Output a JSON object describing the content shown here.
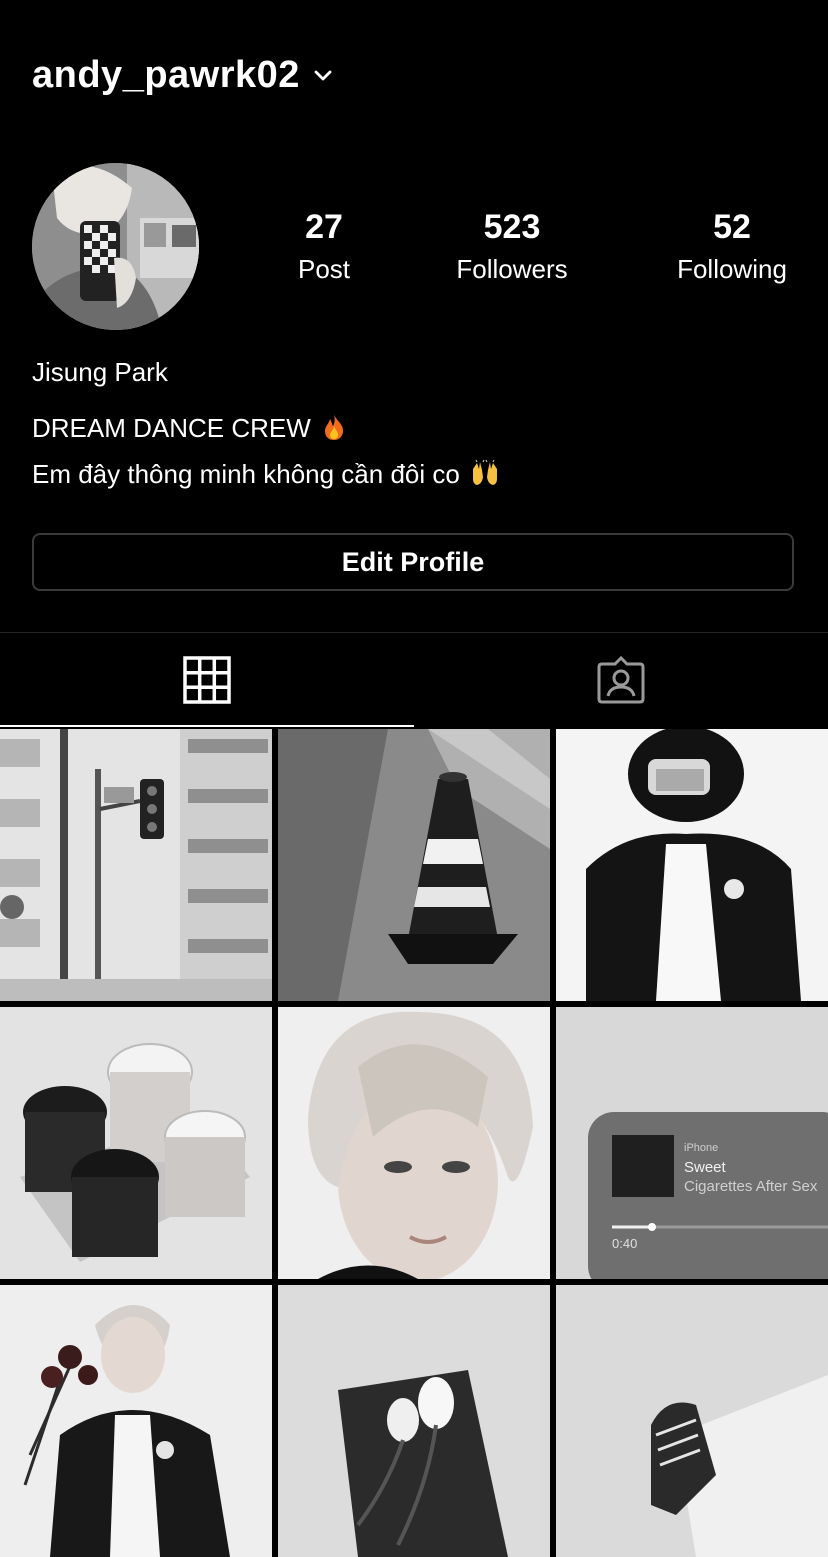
{
  "profile": {
    "username": "andy_pawrk02",
    "display_name": "Jisung Park",
    "bio_line1": "DREAM DANCE CREW",
    "bio_line2": "Em đây thông minh không cần đôi co",
    "stats": [
      {
        "value": "27",
        "label": "Post"
      },
      {
        "value": "523",
        "label": "Followers"
      },
      {
        "value": "52",
        "label": "Following"
      }
    ],
    "edit_button": "Edit Profile"
  },
  "tabs": [
    {
      "icon": "grid-icon",
      "active": true
    },
    {
      "icon": "tagged-person-icon",
      "active": false
    }
  ],
  "posts": [
    {
      "subject": "street-building-traffic-light"
    },
    {
      "subject": "traffic-cone"
    },
    {
      "subject": "person-helmet-blazer"
    },
    {
      "subject": "coffee-cups"
    },
    {
      "subject": "portrait-white-hair"
    },
    {
      "subject": "music-player-card",
      "player_source": "iPhone",
      "song_title": "Sweet",
      "artist": "Cigarettes After Sex",
      "time": "0:40"
    },
    {
      "subject": "person-with-roses"
    },
    {
      "subject": "tulip-bouquet"
    },
    {
      "subject": "sneaker"
    }
  ]
}
